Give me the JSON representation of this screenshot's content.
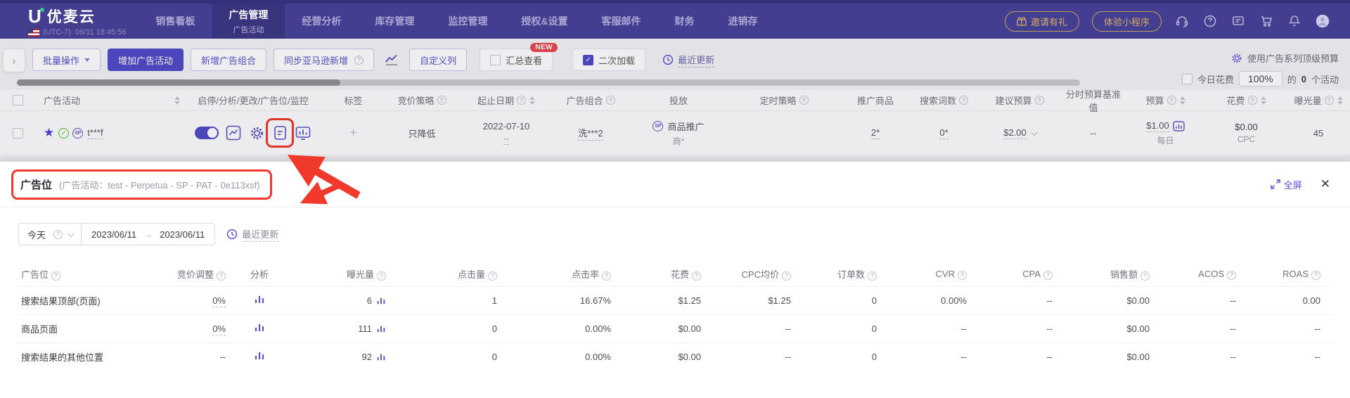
{
  "nav": {
    "logo_text": "优麦云",
    "timezone_text": "(UTC-7): 06/11 18:45:56",
    "items": [
      "销售看板",
      "广告管理",
      "经营分析",
      "库存管理",
      "监控管理",
      "授权&设置",
      "客服邮件",
      "财务",
      "进销存"
    ],
    "active_item": "广告管理",
    "active_subitem": "广告活动",
    "invite_button": "邀请有礼",
    "miniapp_button": "体验小程序"
  },
  "toolbar": {
    "batch_button": "批量操作",
    "add_campaign_button": "增加广告活动",
    "add_portfolio_button": "新增广告组合",
    "sync_amazon_button": "同步亚马逊新增",
    "custom_columns_button": "自定义列",
    "summary_checkbox": "汇总查看",
    "new_badge": "NEW",
    "reload_checkbox": "二次加载",
    "recent_update": "最近更新",
    "use_top_budget": "使用广告系列顶级预算",
    "today_spend_label": "今日花费",
    "today_spend_value": "100%",
    "today_spend_prefix": "的",
    "today_spend_count": "0",
    "today_spend_suffix": "个活动"
  },
  "campaign_table": {
    "headers": [
      "广告活动",
      "启停/分析/更改/广告位/监控",
      "标签",
      "竞价策略",
      "起止日期",
      "广告组合",
      "投放",
      "定时策略",
      "推广商品",
      "搜索词数",
      "建议预算",
      "分时预算基准值",
      "预算",
      "花费",
      "曝光量"
    ],
    "row": {
      "name": "t***f",
      "tag_add": "+",
      "bid_strategy": "只降低",
      "date_start": "2022-07-10",
      "date_end": "--",
      "portfolio": "洗***2",
      "type_badge": "SP",
      "type": "商品推广",
      "type_sub": "商*",
      "products": "2*",
      "search_terms": "0*",
      "suggested_budget": "$2.00",
      "hourly_budget_base": "--",
      "budget": "$1.00",
      "budget_cycle": "每日",
      "spend": "$0.00",
      "spend_sub": "CPC",
      "impressions": "45"
    }
  },
  "placement_panel": {
    "title": "广告位",
    "subtitle": "(广告活动：test - Perpetua - SP - PAT - 0e113xsf)",
    "fullscreen_label": "全屏",
    "date_preset": "今天",
    "date_from": "2023/06/11",
    "date_to": "2023/06/11",
    "recent_update": "最近更新",
    "table": {
      "headers": [
        "广告位",
        "竞价调整",
        "分析",
        "曝光量",
        "点击量",
        "点击率",
        "花费",
        "CPC均价",
        "订单数",
        "CVR",
        "CPA",
        "销售额",
        "ACOS",
        "ROAS"
      ],
      "rows": [
        {
          "placement": "搜索结果顶部(页面)",
          "bid_adj": "0%",
          "impressions": "6",
          "clicks": "1",
          "ctr": "16.67%",
          "spend": "$1.25",
          "cpc": "$1.25",
          "orders": "0",
          "cvr": "0.00%",
          "cpa": "--",
          "sales": "$0.00",
          "acos": "--",
          "roas": "0.00"
        },
        {
          "placement": "商品页面",
          "bid_adj": "0%",
          "impressions": "111",
          "clicks": "0",
          "ctr": "0.00%",
          "spend": "$0.00",
          "cpc": "--",
          "orders": "0",
          "cvr": "--",
          "cpa": "--",
          "sales": "$0.00",
          "acos": "--",
          "roas": "--"
        },
        {
          "placement": "搜索结果的其他位置",
          "bid_adj": "--",
          "impressions": "92",
          "clicks": "0",
          "ctr": "0.00%",
          "spend": "$0.00",
          "cpc": "--",
          "orders": "0",
          "cvr": "--",
          "cpa": "--",
          "sales": "$0.00",
          "acos": "--",
          "roas": "--"
        }
      ]
    }
  },
  "colors": {
    "nav_bg": "#433e90",
    "primary": "#4f4ac6",
    "gold": "#d3ac67",
    "annotation_red": "#f0382b",
    "new_badge_red": "#e5484d",
    "success_green": "#52c41a"
  }
}
